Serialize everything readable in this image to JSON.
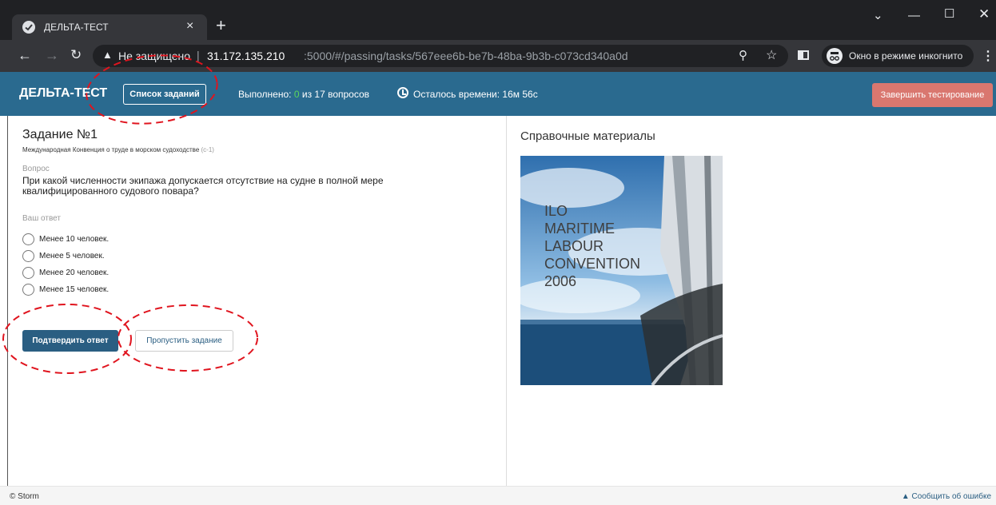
{
  "browser": {
    "tab_title": "ДЕЛЬТА-ТЕСТ",
    "tab_close": "×",
    "new_tab": "+",
    "not_secure": "Не защищено",
    "url_separator": "|",
    "url_host": "31.172.135.210",
    "url_rest": ":5000/#/passing/tasks/567eee6b-be7b-48ba-9b3b-c073cd340a0d",
    "incognito_label": "Окно в режиме инкогнито"
  },
  "header": {
    "brand": "ДЕЛЬТА-ТЕСТ",
    "task_list_button": "Список заданий",
    "progress_prefix": "Выполнено:",
    "done_count": "0",
    "progress_suffix": "из 17 вопросов",
    "timer": "Осталось времени: 16м 56с",
    "finish_button": "Завершить тестирование",
    "colors": {
      "header_bg": "#2a6a8f",
      "finish_bg": "#d9776f",
      "done_count": "#5cd65c"
    }
  },
  "task": {
    "title": "Задание №1",
    "subtitle": "Международная Конвенция о труде в морском судоходстве",
    "subtitle_code": "(c-1)",
    "question_label": "Вопрос",
    "question_text": "При какой численности экипажа допускается отсутствие на судне в полной мере квалифицированного судового повара?",
    "answer_label": "Ваш ответ",
    "options": [
      "Менее 10 человек.",
      "Менее 5 человек.",
      "Менее 20 человек.",
      "Менее 15 человек."
    ],
    "confirm_button": "Подтвердить ответ",
    "skip_button": "Пропустить задание"
  },
  "reference": {
    "title": "Справочные материалы",
    "image_text": "ILO\nMARITIME\nLABOUR\nCONVENTION\n2006"
  },
  "footer": {
    "copyright": "© Storm",
    "report_link": "Сообщить об ошибке"
  }
}
